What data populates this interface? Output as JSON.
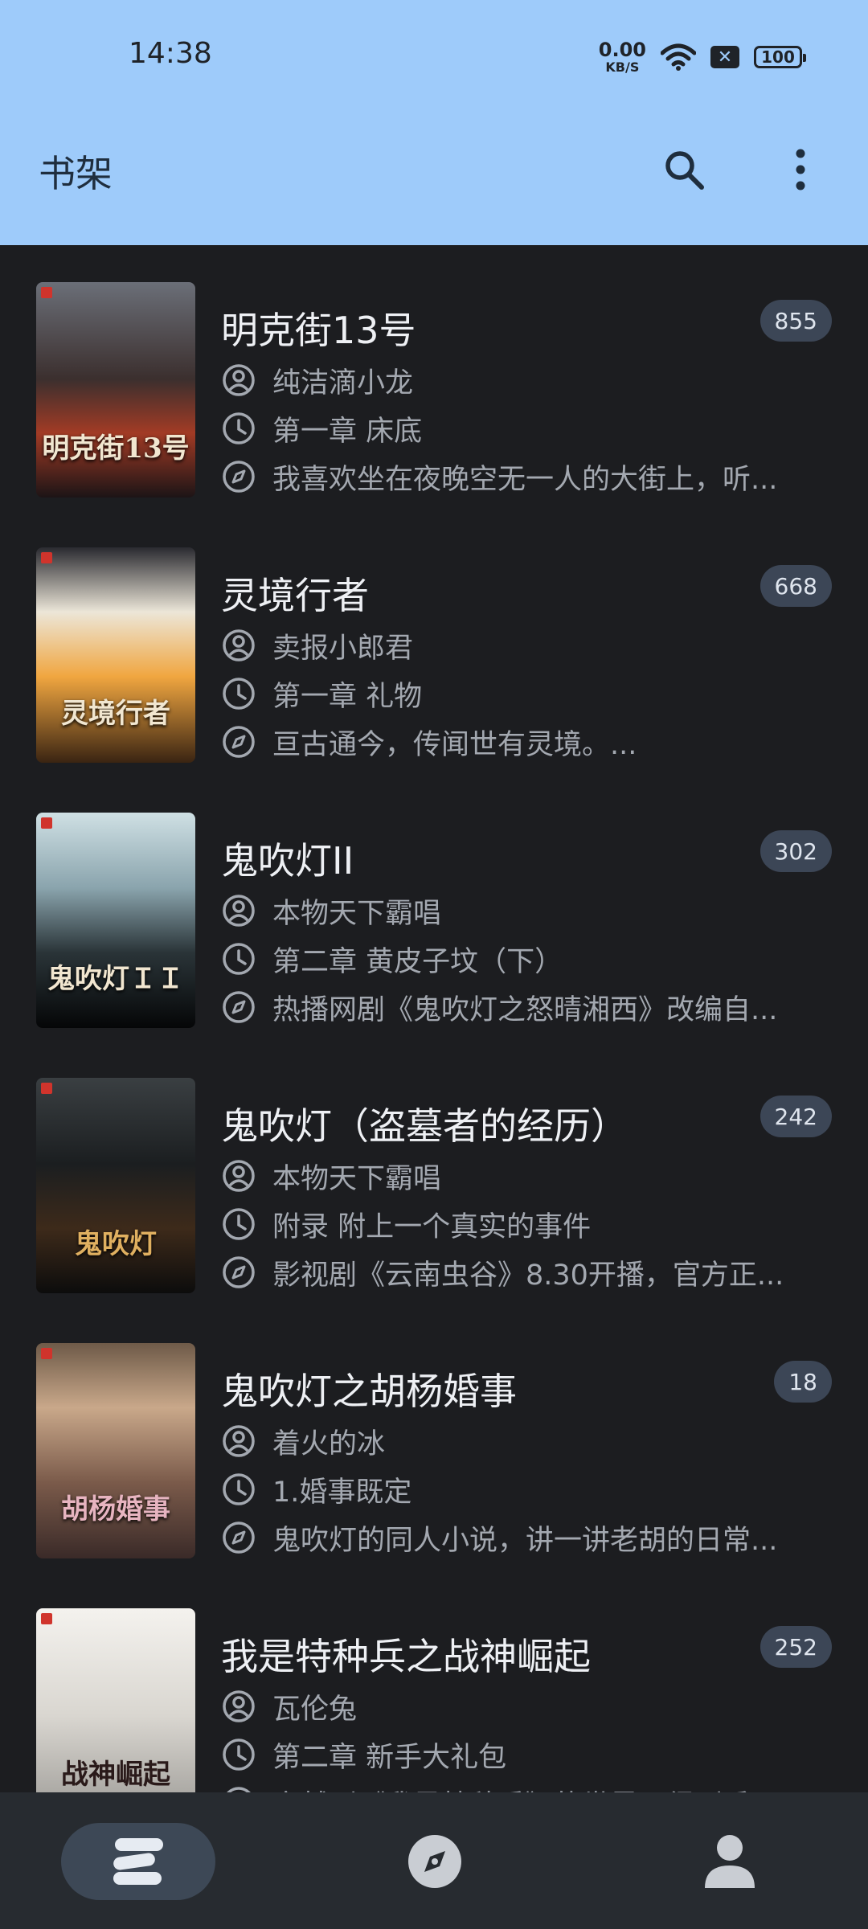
{
  "status_bar": {
    "time": "14:38",
    "net_speed": "0.00",
    "net_unit": "KB/S",
    "battery": "100"
  },
  "app_bar": {
    "title": "书架",
    "search_icon": "search-icon",
    "more_icon": "more-vert-icon"
  },
  "books": [
    {
      "title": "明克街13号",
      "author": "纯洁滴小龙",
      "chapter": "第一章 床底",
      "intro": "我喜欢坐在夜晚空无一人的大街上，听...",
      "count": "855",
      "cover_text": "明克街13号"
    },
    {
      "title": "灵境行者",
      "author": "卖报小郎君",
      "chapter": "第一章 礼物",
      "intro": "亘古通今，传闻世有灵境。...",
      "count": "668",
      "cover_text": "灵境行者"
    },
    {
      "title": "鬼吹灯II",
      "author": "本物天下霸唱",
      "chapter": "第二章 黄皮子坟（下）",
      "intro": "热播网剧《鬼吹灯之怒晴湘西》改编自...",
      "count": "302",
      "cover_text": "鬼吹灯ＩＩ"
    },
    {
      "title": "鬼吹灯（盗墓者的经历）",
      "author": "本物天下霸唱",
      "chapter": "附录 附上一个真实的事件",
      "intro": "影视剧《云南虫谷》8.30开播，官方正...",
      "count": "242",
      "cover_text": "鬼吹灯"
    },
    {
      "title": "鬼吹灯之胡杨婚事",
      "author": "着火的冰",
      "chapter": "1.婚事既定",
      "intro": "鬼吹灯的同人小说，讲一讲老胡的日常...",
      "count": "18",
      "cover_text": "胡杨婚事"
    },
    {
      "title": "我是特种兵之战神崛起",
      "author": "瓦伦兔",
      "chapter": "第二章 新手大礼包",
      "intro": "穿越到《我是特种兵》的世界，得到系...",
      "count": "252",
      "cover_text": "战神崛起"
    }
  ],
  "bottom_nav": {
    "shelf_icon": "bookshelf-icon",
    "discover_icon": "compass-icon",
    "profile_icon": "person-icon"
  },
  "colors": {
    "app_bar": "#9ecbfa",
    "background": "#1c1d20",
    "badge": "#3c4656",
    "nav_bg": "#272b30"
  }
}
